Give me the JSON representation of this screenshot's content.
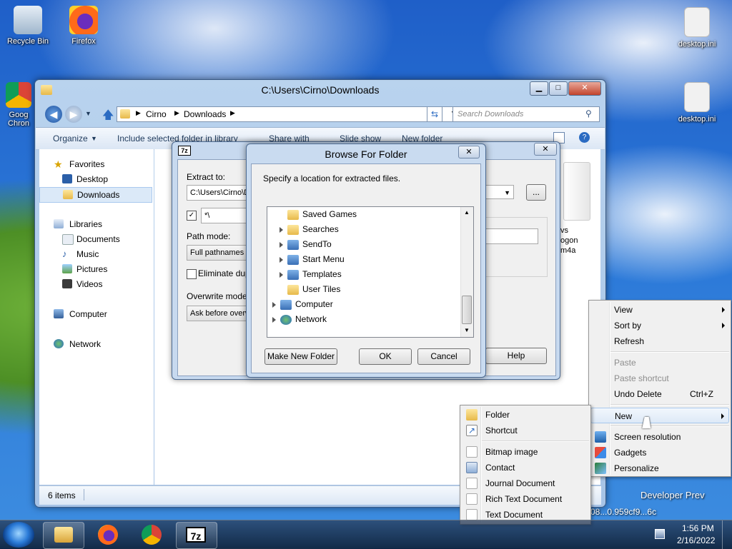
{
  "desktop": {
    "icons": [
      {
        "label": "Recycle Bin",
        "icon": "recycle-bin-icon"
      },
      {
        "label": "Firefox",
        "icon": "firefox-icon"
      },
      {
        "label": "desktop.ini",
        "icon": "settings-file-icon"
      },
      {
        "label": "desktop.ini",
        "icon": "settings-file-icon"
      },
      {
        "label": "Goog\nChron",
        "icon": "chrome-icon"
      }
    ],
    "watermark": {
      "line1": "Developer Prev",
      "line2": "08...0.959cf9...6c"
    }
  },
  "explorer": {
    "title": "C:\\Users\\Cirno\\Downloads",
    "breadcrumb": [
      "Cirno",
      "Downloads"
    ],
    "search_placeholder": "Search Downloads",
    "toolbar": {
      "organize": "Organize",
      "include": "Include selected folder in library",
      "share": "Share with",
      "slideshow": "Slide show",
      "new_folder": "New folder"
    },
    "nav": {
      "favorites": "Favorites",
      "desktop": "Desktop",
      "downloads": "Downloads",
      "libraries": "Libraries",
      "documents": "Documents",
      "music": "Music",
      "pictures": "Pictures",
      "videos": "Videos",
      "computer": "Computer",
      "network": "Network"
    },
    "content_partial": {
      "line1": "vs",
      "line2": "ogon",
      "line3": "m4a"
    },
    "status": "6 items"
  },
  "zip_dialog": {
    "app_badge": "7z",
    "extract_to_label": "Extract to:",
    "extract_to_value": "C:\\Users\\Cirno\\D",
    "browse_button": "...",
    "subfolder_value": "*\\",
    "path_mode_label": "Path mode:",
    "path_mode_value": "Full pathnames",
    "eliminate_label": "Eliminate dupli",
    "overwrite_label": "Overwrite mode:",
    "overwrite_value": "Ask before overw",
    "help_button": "Help"
  },
  "browse": {
    "title": "Browse For Folder",
    "instruction": "Specify a location for extracted files.",
    "tree": [
      {
        "label": "Saved Games",
        "expandable": false
      },
      {
        "label": "Searches",
        "expandable": true
      },
      {
        "label": "SendTo",
        "expandable": true
      },
      {
        "label": "Start Menu",
        "expandable": true
      },
      {
        "label": "Templates",
        "expandable": true
      },
      {
        "label": "User Tiles",
        "expandable": false
      },
      {
        "label": "Computer",
        "expandable": true
      },
      {
        "label": "Network",
        "expandable": true
      }
    ],
    "make_new_folder": "Make New Folder",
    "ok": "OK",
    "cancel": "Cancel"
  },
  "context_menu": {
    "items": [
      {
        "label": "View",
        "submenu": true
      },
      {
        "label": "Sort by",
        "submenu": true
      },
      {
        "label": "Refresh"
      },
      {
        "label": "Paste",
        "disabled": true
      },
      {
        "label": "Paste shortcut",
        "disabled": true
      },
      {
        "label": "Undo Delete",
        "shortcut": "Ctrl+Z"
      },
      {
        "label": "New",
        "submenu": true
      },
      {
        "label": "Screen resolution"
      },
      {
        "label": "Gadgets"
      },
      {
        "label": "Personalize"
      }
    ]
  },
  "new_submenu": {
    "items": [
      {
        "label": "Folder"
      },
      {
        "label": "Shortcut"
      },
      {
        "label": "Bitmap image"
      },
      {
        "label": "Contact"
      },
      {
        "label": "Journal Document"
      },
      {
        "label": "Rich Text Document"
      },
      {
        "label": "Text Document"
      }
    ]
  },
  "taskbar": {
    "pinned": [
      "explorer-icon",
      "firefox-icon",
      "chrome-icon",
      "7zip-icon"
    ],
    "zip_label": "7z",
    "time": "1:56 PM",
    "date": "2/16/2022"
  }
}
